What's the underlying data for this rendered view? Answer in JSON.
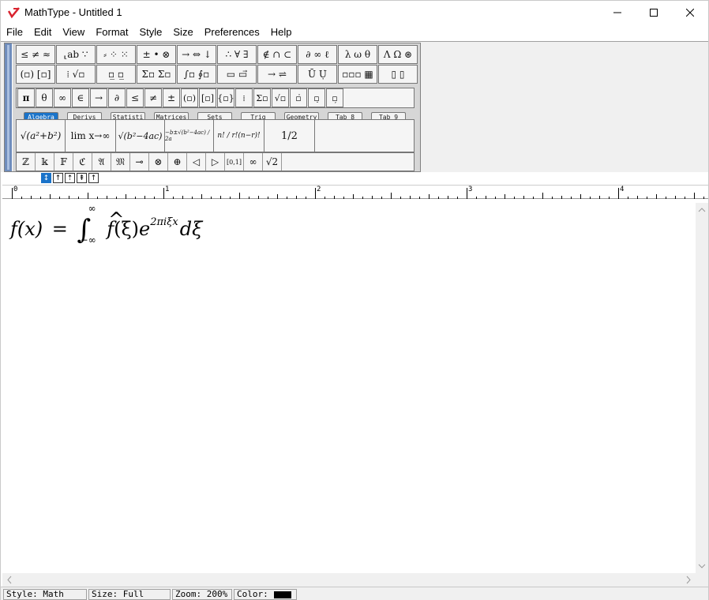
{
  "window": {
    "title": "MathType - Untitled 1",
    "controls": {
      "minimize": "—",
      "maximize": "☐",
      "close": "✕"
    }
  },
  "menubar": [
    "File",
    "Edit",
    "View",
    "Format",
    "Style",
    "Size",
    "Preferences",
    "Help"
  ],
  "toolbar": {
    "row1": [
      "≤ ≠ ≈",
      "⸤ab ∵",
      "⸗ ⁘ ⁙",
      "± • ⊗",
      "→ ⇔ ↓",
      "∴ ∀ ∃",
      "∉ ∩ ⊂",
      "∂ ∞ ℓ",
      "λ ω θ",
      "Λ Ω ⊛"
    ],
    "row2": [
      "(▫) [▫]",
      "⁞ √▫",
      "▫̲ ▫̲",
      "Σ▫ Σ▫",
      "∫▫ ∮▫",
      "▭ ▭⃗",
      "→ ⇌",
      "Ū Ụ̇",
      "▫▫▫ ▦",
      "▯ ▯"
    ],
    "row3": [
      "π",
      "θ",
      "∞",
      "∈",
      "→",
      "∂",
      "≤",
      "≠",
      "±",
      "(▫)",
      "[▫]",
      "{▫}",
      "⁞",
      "Σ▫",
      "√▫",
      "▫̇",
      "▫̣",
      "▫̦"
    ],
    "tabs": [
      "Algebra",
      "Derivs",
      "Statisti",
      "Matrices",
      "Sets",
      "Trig",
      "Geometry",
      "Tab 8",
      "Tab 9"
    ],
    "templates": [
      "√(a²+b²)",
      "lim x→∞",
      "√(b²−4ac)",
      "−b±√(b²−4ac) / 2a",
      "n! / r!(n−r)!",
      "1/2"
    ],
    "row5": [
      "ℤ",
      "𝕜",
      "𝔽",
      "ℭ",
      "𝔄",
      "𝔐",
      "⊸",
      "⊗",
      "⊕",
      "◁",
      "▷",
      "[0,1]",
      "∞",
      "√2"
    ]
  },
  "nudge_buttons": [
    "↕",
    "↑",
    "⇡",
    "⇞",
    "↑"
  ],
  "ruler": {
    "labels": [
      "0",
      "1",
      "2",
      "3",
      "4"
    ]
  },
  "equation": {
    "lhs": "f(x)",
    "equals": "=",
    "integral": "∫",
    "upper": "∞",
    "lower": "−∞",
    "fhat": "f",
    "hat": "^",
    "arg": "(ξ)",
    "base": "e",
    "exponent": "2πiξx",
    "diff": "dξ"
  },
  "statusbar": {
    "style": "Style: Math",
    "size": "Size: Full",
    "zoom": "Zoom: 200%",
    "color_label": "Color:",
    "color_value": "#000000"
  }
}
